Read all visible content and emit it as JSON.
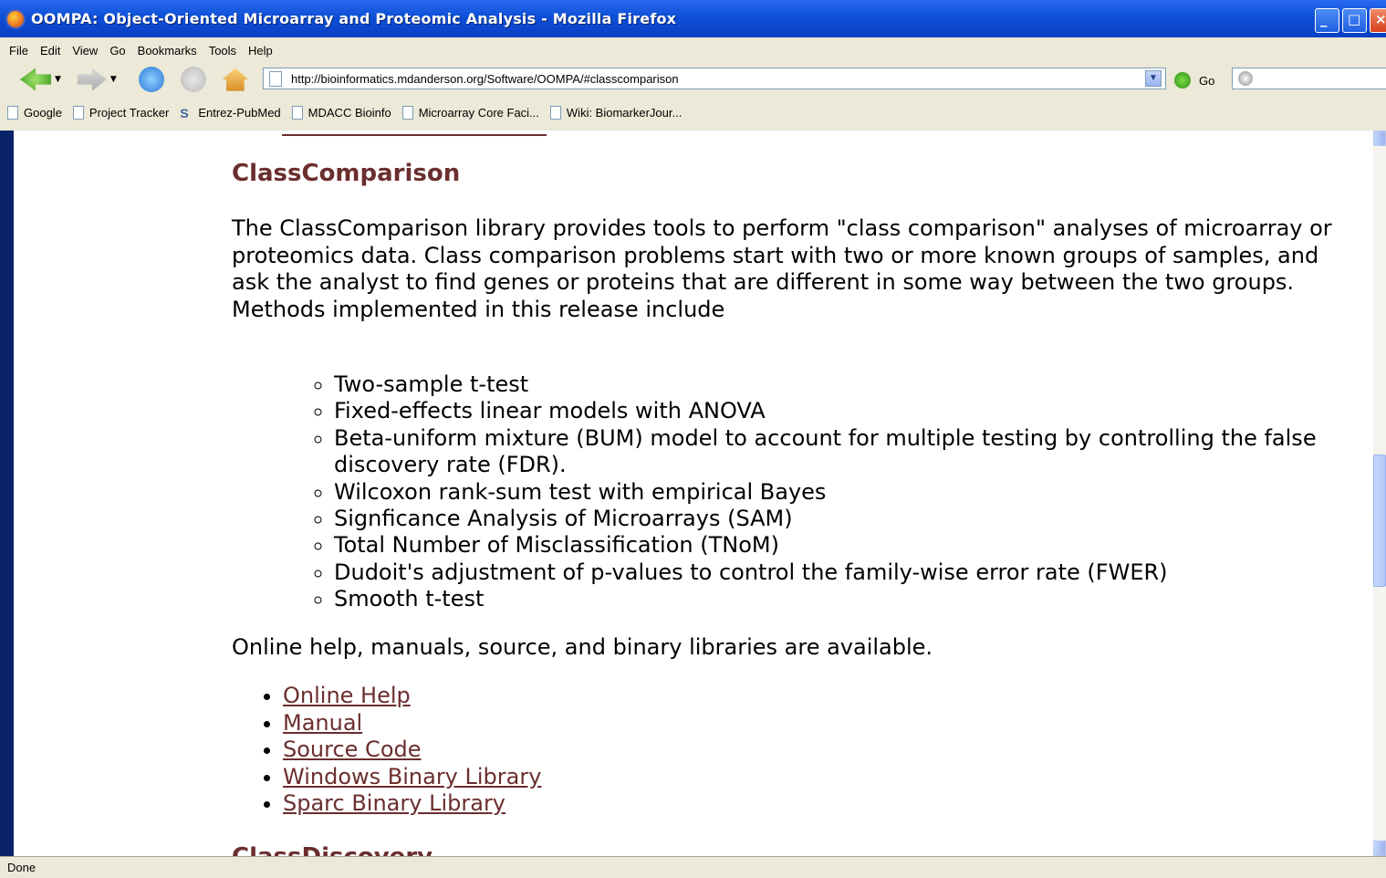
{
  "window": {
    "title": "OOMPA: Object-Oriented Microarray and Proteomic Analysis - Mozilla Firefox"
  },
  "menu": [
    "File",
    "Edit",
    "View",
    "Go",
    "Bookmarks",
    "Tools",
    "Help"
  ],
  "address": {
    "url": "http://bioinformatics.mdanderson.org/Software/OOMPA/#classcomparison",
    "go_label": "Go"
  },
  "bookmarks": [
    "Google",
    "Project Tracker",
    "Entrez-PubMed",
    "MDACC Bioinfo",
    "Microarray Core Faci...",
    "Wiki: BiomarkerJour..."
  ],
  "content": {
    "heading": "ClassComparison",
    "intro": "The ClassComparison library provides tools to perform \"class comparison\" analyses of microarray or proteomics data. Class comparison problems start with two or more known groups of samples, and ask the analyst to find genes or proteins that are different in some way between the two groups. Methods implemented in this release include",
    "methods": [
      "Two-sample t-test",
      "Fixed-effects linear models with ANOVA",
      "Beta-uniform mixture (BUM) model to account for multiple testing by controlling the false discovery rate (FDR).",
      "Wilcoxon rank-sum test with empirical Bayes",
      "Signficance Analysis of Microarrays (SAM)",
      "Total Number of Misclassification (TNoM)",
      "Dudoit's adjustment of p-values to control the family-wise error rate (FWER)",
      "Smooth t-test"
    ],
    "availability": "Online help, manuals, source, and binary libraries are available.",
    "links": [
      "Online Help",
      "Manual",
      "Source Code",
      "Windows Binary Library",
      "Sparc Binary Library"
    ],
    "next_heading": "ClassDiscovery"
  },
  "status": {
    "text": "Done"
  },
  "colors": {
    "heading": "#6b2e2e",
    "link": "#6b2e2e",
    "titlebar": "#0c4fd6"
  }
}
